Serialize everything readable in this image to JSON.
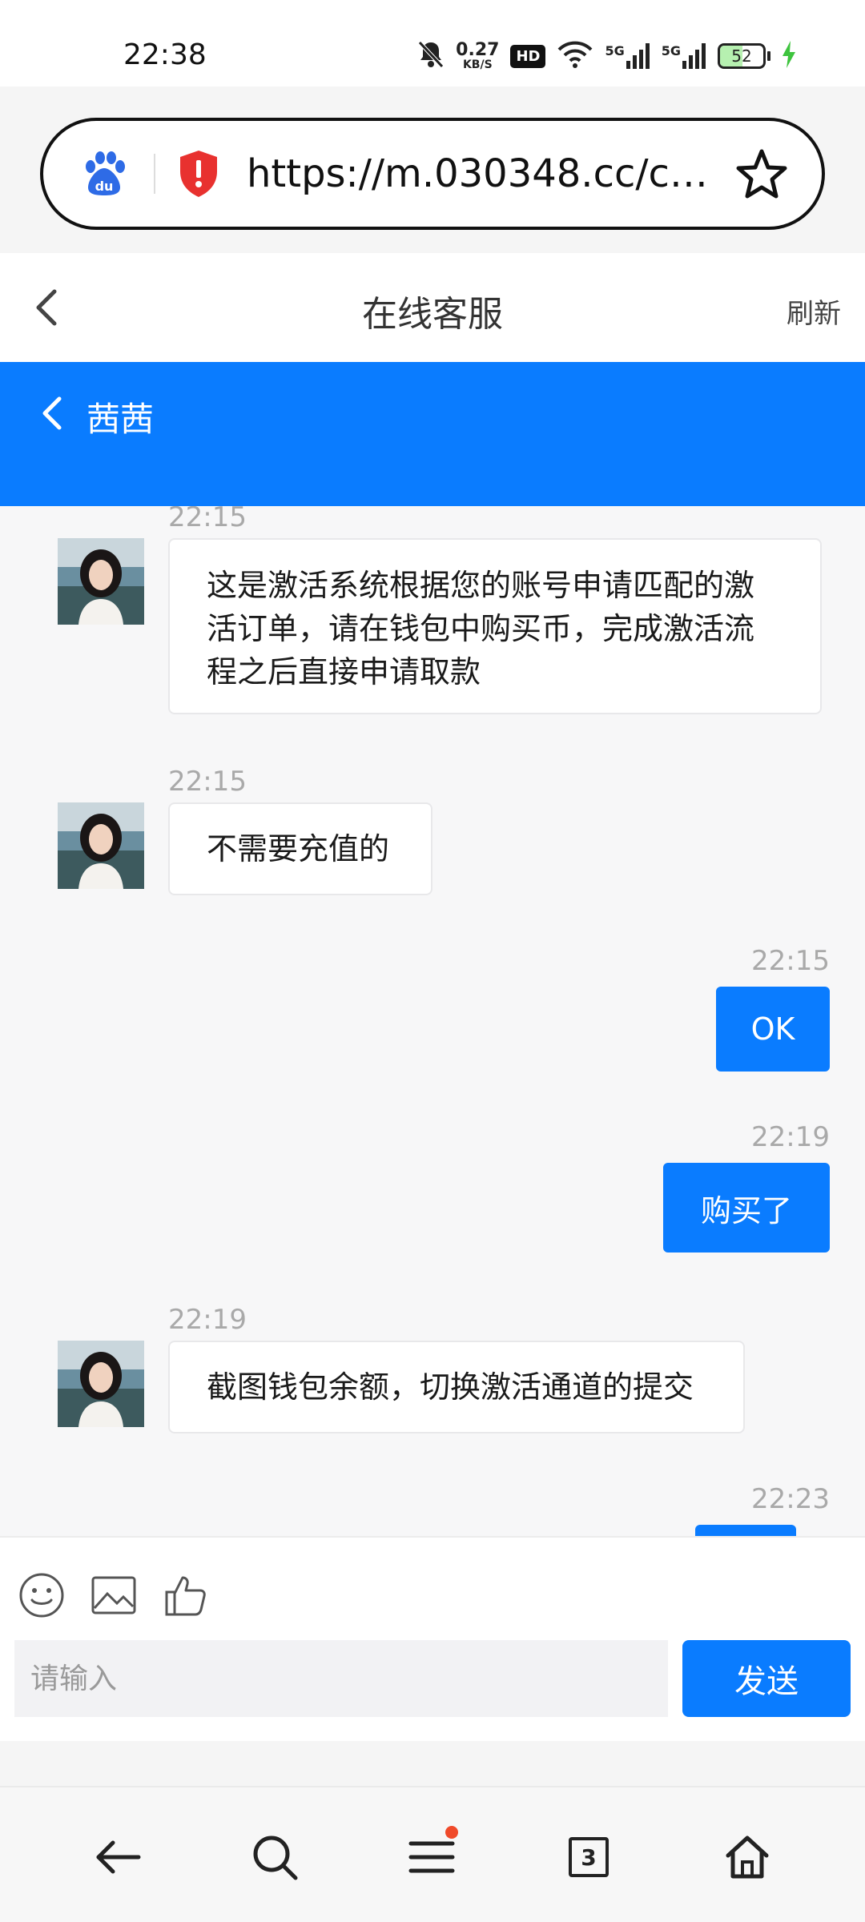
{
  "status_bar": {
    "time": "22:38",
    "net_speed_value": "0.27",
    "net_speed_unit": "KB/S",
    "hd_label": "HD",
    "signal1_label": "5G",
    "signal2_label": "5G",
    "battery_level": "52",
    "battery_fraction": 0.52,
    "icons": [
      "mute-bell-icon",
      "wifi-icon",
      "signal-icon",
      "signal-icon",
      "battery-icon",
      "charging-icon"
    ]
  },
  "browser": {
    "url": "https://m.030348.cc/chs/...",
    "icons": [
      "baidu-icon",
      "security-shield-icon",
      "bookmark-star-icon"
    ]
  },
  "page_header": {
    "title": "在线客服",
    "refresh_label": "刷新"
  },
  "chat_header": {
    "agent_name": "茜茜"
  },
  "messages": [
    {
      "side": "in",
      "time": "22:15",
      "text": "这是激活系统根据您的账号申请匹配的激活订单，请在钱包中购买币，完成激活流程之后直接申请取款"
    },
    {
      "side": "in",
      "time": "22:15",
      "text": "不需要充值的"
    },
    {
      "side": "out",
      "time": "22:15",
      "text": "OK"
    },
    {
      "side": "out",
      "time": "22:19",
      "text": "购买了"
    },
    {
      "side": "in",
      "time": "22:19",
      "text": "截图钱包余额，切换激活通道的提交"
    },
    {
      "side": "out",
      "time": "22:23",
      "text": ""
    }
  ],
  "composer": {
    "placeholder": "请输入",
    "send_label": "发送",
    "tools": [
      "emoji-icon",
      "image-icon",
      "thumbs-up-icon"
    ]
  },
  "bottom_nav": {
    "tab_count": "3",
    "items": [
      "back-arrow-icon",
      "search-icon",
      "menu-icon",
      "tabs-icon",
      "home-icon"
    ],
    "menu_badge_color": "#f04a2a"
  },
  "colors": {
    "accent": "#0a7cff",
    "shield": "#e8312f",
    "baidu": "#2e6be6"
  }
}
